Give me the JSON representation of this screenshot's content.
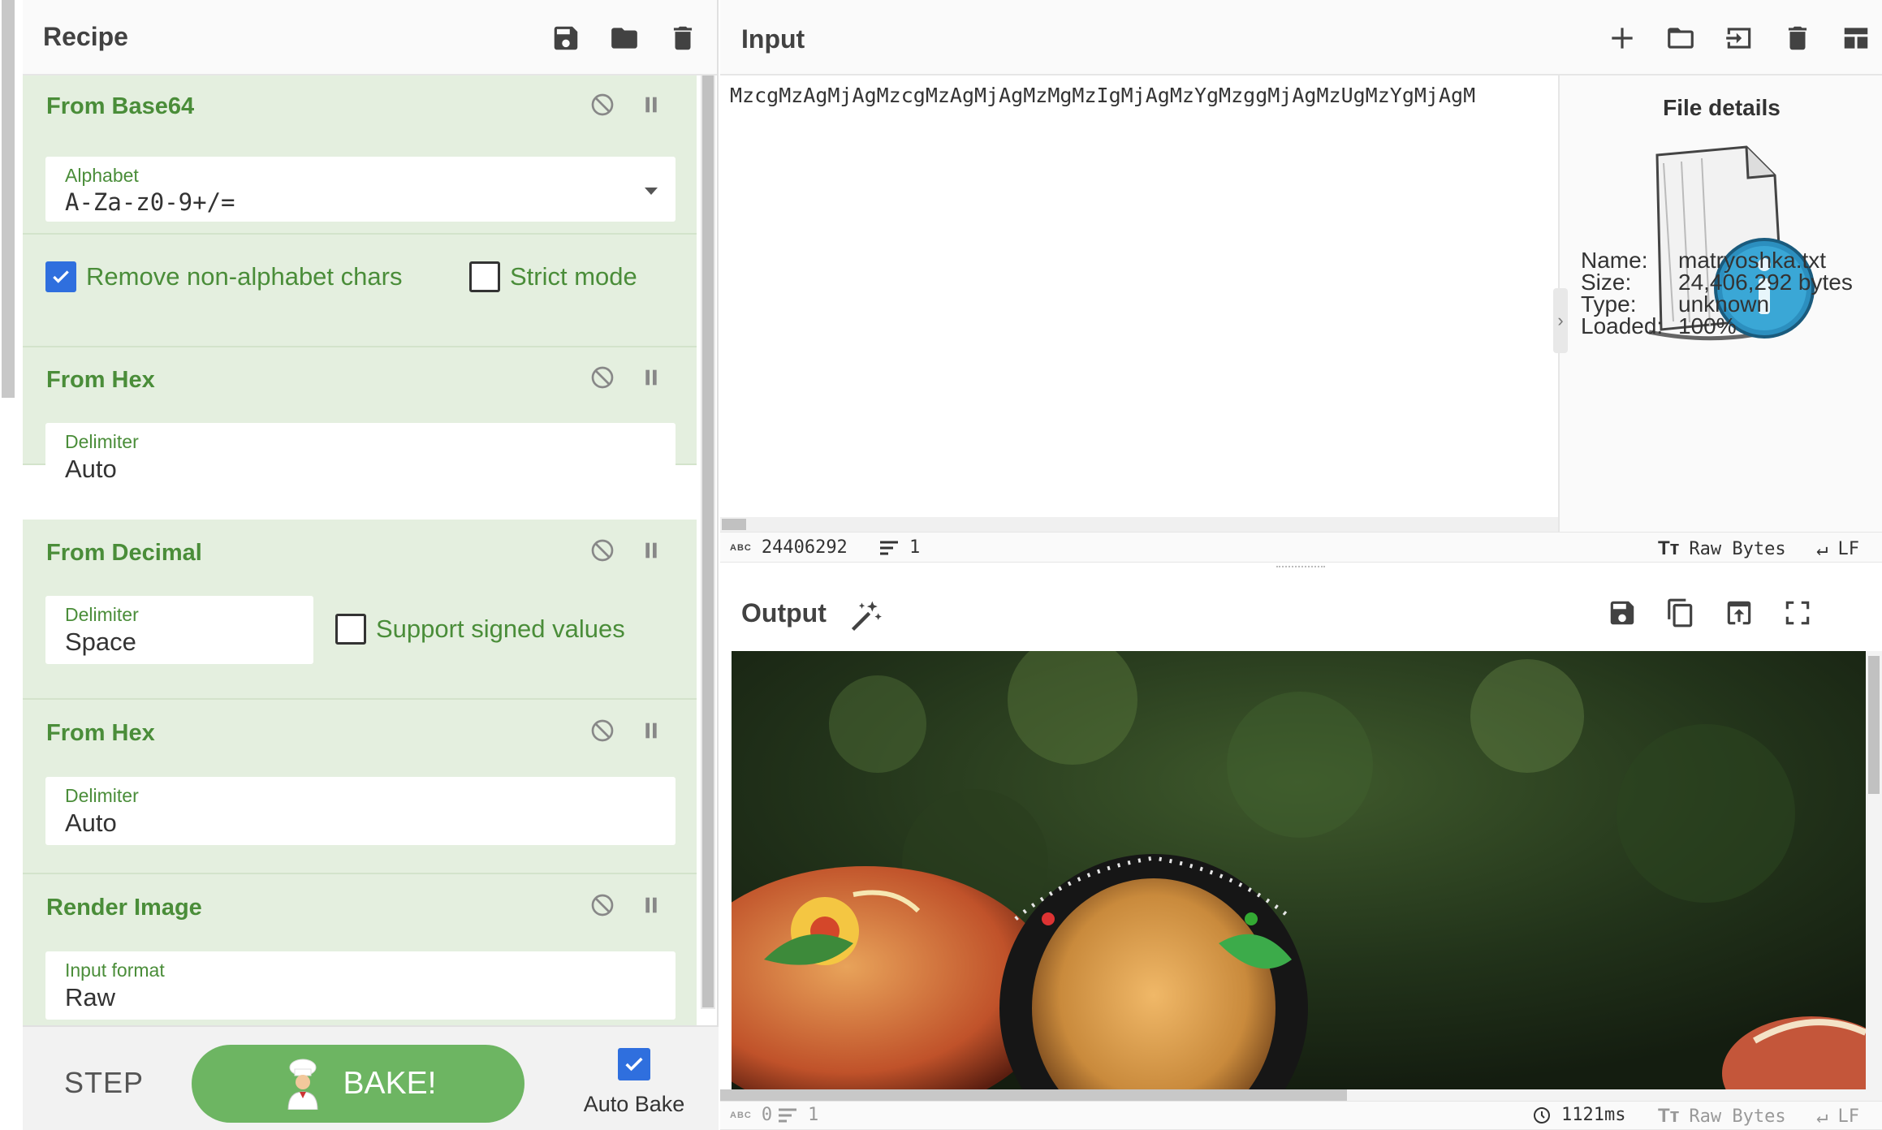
{
  "recipe": {
    "title": "Recipe",
    "operations": [
      {
        "name": "From Base64",
        "fields": [
          {
            "label": "Alphabet",
            "value": "A-Za-z0-9+/="
          }
        ],
        "checkboxes": [
          {
            "label": "Remove non-alphabet chars",
            "checked": true
          },
          {
            "label": "Strict mode",
            "checked": false
          }
        ]
      },
      {
        "name": "From Hex",
        "fields": [
          {
            "label": "Delimiter",
            "value": "Auto"
          }
        ]
      },
      {
        "name": "From Decimal",
        "fields": [
          {
            "label": "Delimiter",
            "value": "Space"
          }
        ],
        "checkboxes": [
          {
            "label": "Support signed values",
            "checked": false
          }
        ]
      },
      {
        "name": "From Hex",
        "fields": [
          {
            "label": "Delimiter",
            "value": "Auto"
          }
        ]
      },
      {
        "name": "Render Image",
        "fields": [
          {
            "label": "Input format",
            "value": "Raw"
          }
        ]
      }
    ],
    "controls": {
      "step": "STEP",
      "bake": "BAKE!",
      "auto_bake": "Auto Bake",
      "auto_bake_checked": true
    }
  },
  "input": {
    "title": "Input",
    "text": "MzcgMzAgMjAgMzcgMzAgMjAgMzMgMzIgMjAgMzYgMzggMjAgMzUgMzYgMjAgM",
    "status": {
      "length": "24406292",
      "lines": "1",
      "encoding": "Raw Bytes",
      "eol": "LF"
    }
  },
  "file_details": {
    "title": "File details",
    "name_label": "Name:",
    "name": "matryoshka.txt",
    "size_label": "Size:",
    "size": "24,406,292 bytes",
    "type_label": "Type:",
    "type": "unknown",
    "loaded_label": "Loaded:",
    "loaded": "100%"
  },
  "output": {
    "title": "Output",
    "status": {
      "length": "0",
      "lines": "1",
      "time": "1121ms",
      "encoding": "Raw Bytes",
      "eol": "LF"
    }
  },
  "colors": {
    "op_bg": "#e4efdf",
    "op_green": "#4a8d39",
    "bake_green": "#6db562",
    "check_blue": "#2f6fde"
  }
}
